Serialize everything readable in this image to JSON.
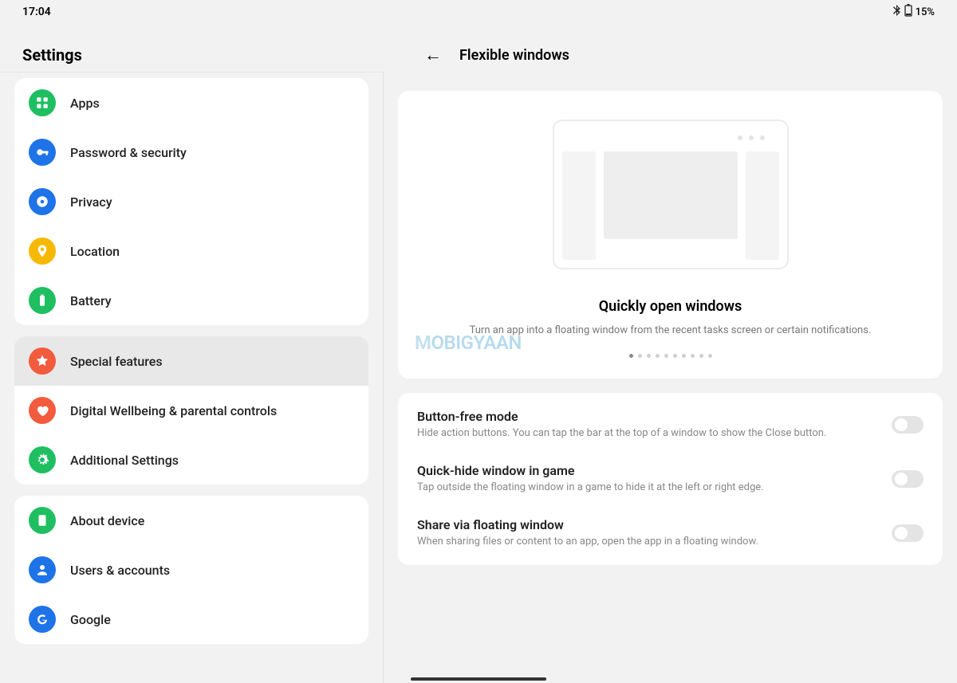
{
  "statusbar": {
    "time": "17:04",
    "battery_pct": "15%"
  },
  "sidebar_title": "Settings",
  "detail_title": "Flexible windows",
  "sidebar": {
    "groups": [
      {
        "items": [
          {
            "id": "apps",
            "label": "Apps",
            "color": "#1fbf61"
          },
          {
            "id": "password-security",
            "label": "Password & security",
            "color": "#1e73e8"
          },
          {
            "id": "privacy",
            "label": "Privacy",
            "color": "#1e73e8"
          },
          {
            "id": "location",
            "label": "Location",
            "color": "#f6b900"
          },
          {
            "id": "battery",
            "label": "Battery",
            "color": "#1fbf61"
          }
        ]
      },
      {
        "items": [
          {
            "id": "special-features",
            "label": "Special features",
            "color": "#f25b3d",
            "active": true
          },
          {
            "id": "digital-wellbeing",
            "label": "Digital Wellbeing & parental controls",
            "color": "#f25b3d"
          },
          {
            "id": "additional-settings",
            "label": "Additional Settings",
            "color": "#1fbf61"
          }
        ]
      },
      {
        "items": [
          {
            "id": "about-device",
            "label": "About device",
            "color": "#1fbf61"
          },
          {
            "id": "users-accounts",
            "label": "Users & accounts",
            "color": "#1e73e8"
          },
          {
            "id": "google",
            "label": "Google",
            "color": "#1e73e8"
          }
        ]
      }
    ]
  },
  "carousel": {
    "title": "Quickly open windows",
    "desc": "Turn an app into a floating window from the recent tasks screen or certain notifications.",
    "page_count": 10,
    "active_page": 0
  },
  "toggles": [
    {
      "id": "button-free-mode",
      "title": "Button-free mode",
      "desc": "Hide action buttons. You can tap the bar at the top of a window to show the Close button.",
      "on": false
    },
    {
      "id": "quick-hide",
      "title": "Quick-hide window in game",
      "desc": "Tap outside the floating window in a game to hide it at the left or right edge.",
      "on": false
    },
    {
      "id": "share-floating",
      "title": "Share via floating window",
      "desc": "When sharing files or content to an app, open the app in a floating window.",
      "on": false
    }
  ],
  "watermark": "MOBIGYAAN"
}
